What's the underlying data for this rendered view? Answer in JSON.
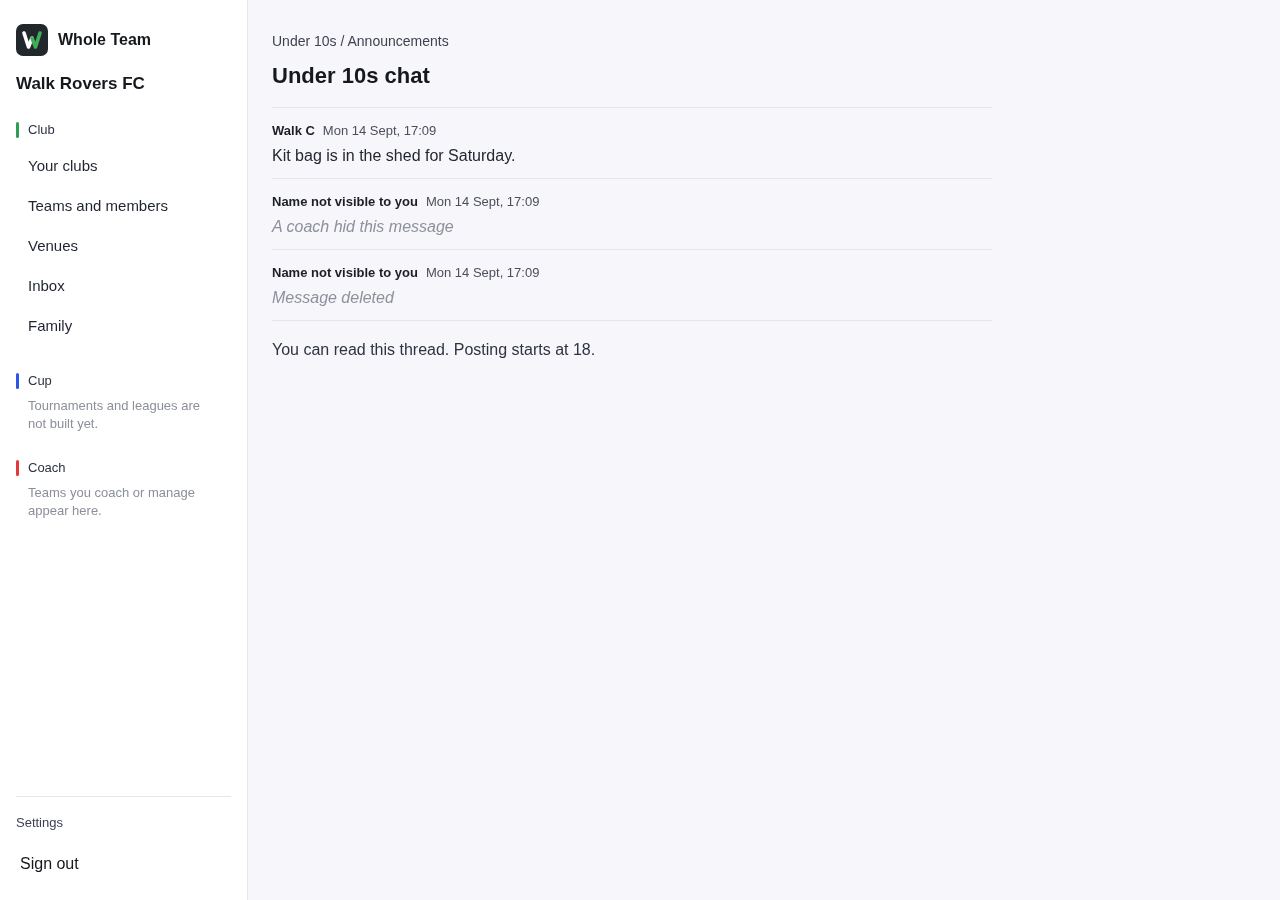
{
  "sidebar": {
    "brand": "Whole Team",
    "club_name": "Walk Rovers FC",
    "sections": [
      {
        "label": "Club",
        "color": "#2f9e55",
        "items": [
          {
            "label": "Your clubs"
          },
          {
            "label": "Teams and members"
          },
          {
            "label": "Venues"
          },
          {
            "label": "Inbox"
          },
          {
            "label": "Family"
          }
        ]
      },
      {
        "label": "Cup",
        "color": "#2b55e6",
        "note": "Tournaments and leagues are not built yet."
      },
      {
        "label": "Coach",
        "color": "#e5383b",
        "note": "Teams you coach or manage appear here."
      }
    ],
    "footer": {
      "settings": "Settings",
      "sign_out": "Sign out"
    }
  },
  "main": {
    "breadcrumb": "Under 10s / Announcements",
    "title": "Under 10s chat",
    "messages": [
      {
        "author": "Walk C",
        "time": "Mon 14 Sept, 17:09",
        "kind": "text",
        "body": "Kit bag is in the shed for Saturday."
      },
      {
        "author": "Name not visible to you",
        "time": "Mon 14 Sept, 17:09",
        "kind": "removed",
        "body": "A coach hid this message"
      },
      {
        "author": "Name not visible to you",
        "time": "Mon 14 Sept, 17:09",
        "kind": "removed",
        "body": "Message deleted"
      }
    ],
    "notice": "You can read this thread. Posting starts at 18."
  }
}
